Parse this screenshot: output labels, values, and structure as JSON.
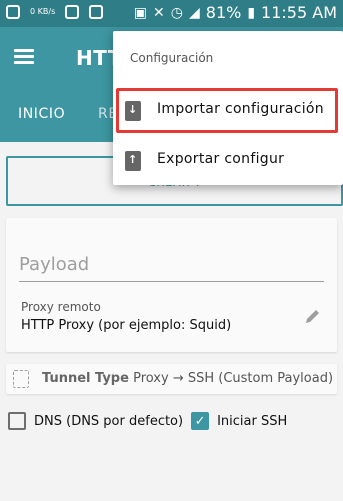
{
  "status_bar": {
    "kbs": "0\nKB/s",
    "battery": "81%",
    "time": "11:55 AM"
  },
  "app_bar": {
    "title": "HTTP"
  },
  "tabs": [
    {
      "label": "INICIO"
    },
    {
      "label": "RE"
    }
  ],
  "connect": {
    "label": "CREAR ?"
  },
  "payload": {
    "placeholder": "Payload",
    "value": ""
  },
  "proxy": {
    "label": "Proxy remoto",
    "value": "HTTP Proxy (por ejemplo: Squid)"
  },
  "tunnel": {
    "type_label": "Tunnel Type",
    "type_value": "Proxy → SSH (Custom Payload)"
  },
  "options": {
    "dns_label": "DNS (DNS por defecto)",
    "dns_checked": false,
    "ssh_label": "Iniciar SSH",
    "ssh_checked": true
  },
  "menu": {
    "header": "Configuración",
    "import_label": "Importar configuración",
    "export_label": "Exportar configur"
  },
  "colors": {
    "primary": "#3d96a1",
    "status_bar": "#2f7d86",
    "highlight": "#e53935"
  }
}
